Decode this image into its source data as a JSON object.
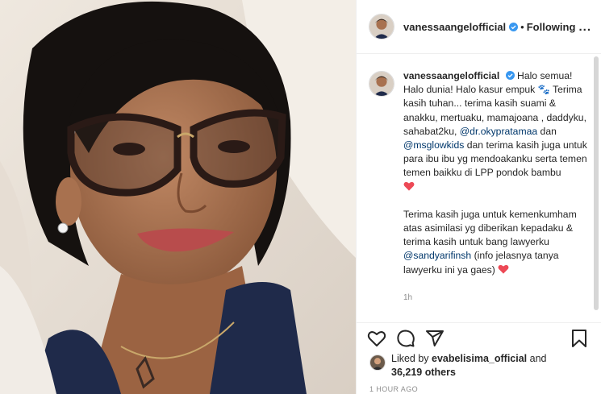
{
  "post": {
    "photo_icon": "selfie-photo",
    "username": "vanessaangelofficial",
    "verified_icon": "verified-badge-icon",
    "separator": "•",
    "follow_state": "Following",
    "more_label": "..."
  },
  "caption": {
    "username": "vanessaangelofficial",
    "text_1": "Halo semua! Halo dunia! Halo kasur empuk ",
    "emoji_1": "🐾",
    "text_2": " Terima kasih tuhan... terima kasih suami & anakku, mertuaku, mamajoana , daddyku, sahabat2ku, ",
    "mention_1": "@dr.okypratamaa",
    "text_3": " dan ",
    "mention_2": "@msglowkids",
    "text_4": " dan terima kasih juga untuk para ibu ibu yg mendoakanku serta temen temen baikku di LPP pondok bambu",
    "text_5": "Terima kasih juga untuk kemenkumham atas asimilasi yg diberikan kepadaku & terima kasih untuk bang lawyerku ",
    "mention_3": "@sandyarifinsh",
    "text_6": " (info jelasnya tanya lawyerku ini ya gaes)",
    "time": "1h",
    "heart_color": "#ed4956"
  },
  "actions": {
    "like_icon": "heart-outline-icon",
    "comment_icon": "comment-icon",
    "share_icon": "paper-plane-icon",
    "save_icon": "bookmark-icon"
  },
  "likes": {
    "prefix": "Liked by ",
    "user": "evabelisima_official",
    "middle": " and ",
    "count": "36,219 others"
  },
  "timestamp": "1 HOUR AGO",
  "colors": {
    "verified": "#3897f0",
    "mention": "#00376b",
    "muted": "#8e8e8e"
  }
}
